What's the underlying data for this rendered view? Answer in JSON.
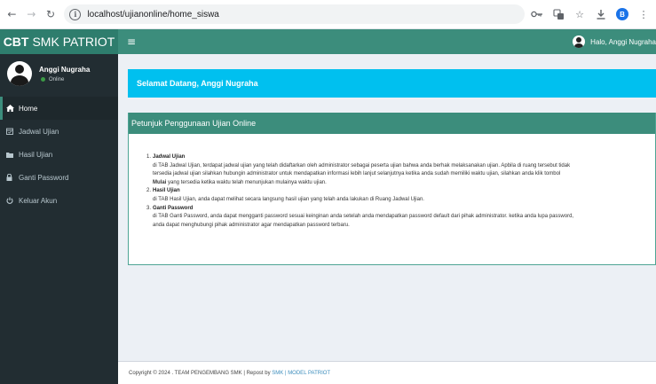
{
  "browser": {
    "url": "localhost/ujianonline/home_siswa",
    "profile_letter": "B"
  },
  "header": {
    "logo_bold": "CBT",
    "logo_rest": "SMK PATRIOT",
    "menu_icon": "hamburger-icon",
    "greeting": "Halo, Anggi Nugraha"
  },
  "sidebar": {
    "user_name": "Anggi Nugraha",
    "user_status": "Online",
    "status_color": "#3c9b46",
    "items": [
      {
        "label": "Home",
        "icon": "home-icon"
      },
      {
        "label": "Jadwal Ujian",
        "icon": "calendar-icon"
      },
      {
        "label": "Hasil Ujian",
        "icon": "folder-icon"
      },
      {
        "label": "Ganti Password",
        "icon": "lock-icon"
      },
      {
        "label": "Keluar Akun",
        "icon": "power-icon"
      }
    ]
  },
  "welcome": {
    "text": "Selamat Datang, Anggi Nugraha"
  },
  "guide": {
    "title": "Petunjuk Penggunaan Ujian Online",
    "items": [
      {
        "num": "1.",
        "title": "Jadwal Ujian",
        "desc_1": "di TAB Jadwal Ujian, terdapat jadwal ujian yang telah didaftarkan oleh administrator sebagai peserta ujian bahwa anda berhak melaksanakan ujian. Apbila di ruang tersebut tidak",
        "desc_2": "tersedia jadwal ujian silahkan hubungin administrator untuk mendapatkan informasi lebih lanjut selanjutnya ketika anda sudah memiliki waktu ujian, silahkan anda klik tombol",
        "desc_3_bold": "Mulai",
        "desc_3_rest": " yang tersedia ketika waktu telah menunjukan mulainya waktu ujian."
      },
      {
        "num": "2.",
        "title": "Hasil Ujian",
        "desc_1": "di TAB Hasil Ujian, anda dapat melihat secara langsung hasil ujian yang telah anda lakukan di Ruang Jadwal Ujian."
      },
      {
        "num": "3.",
        "title": "Ganti Password",
        "desc_1": "di TAB Ganti Password, anda dapat mengganti password sesuai keinginan anda setelah anda mendapatkan password default dari pihak administrator. ketika anda lupa password,",
        "desc_2": "anda dapat menghubungi pihak administrator agar mendapatkan password terbaru."
      }
    ]
  },
  "footer": {
    "prefix": "Copyright © 2024 . TEAM PENGEMBANG SMK | Repost by ",
    "link_1": "SMK",
    "separator": " | ",
    "link_2": "MODEL PATRIOT"
  },
  "colors": {
    "logo_bg": "#2e7d6d",
    "topbar_bg": "#3c8d7c",
    "sidebar_bg": "#222d32",
    "welcome_bg": "#00c0ef",
    "guide_header_bg": "#3c8d7c"
  }
}
